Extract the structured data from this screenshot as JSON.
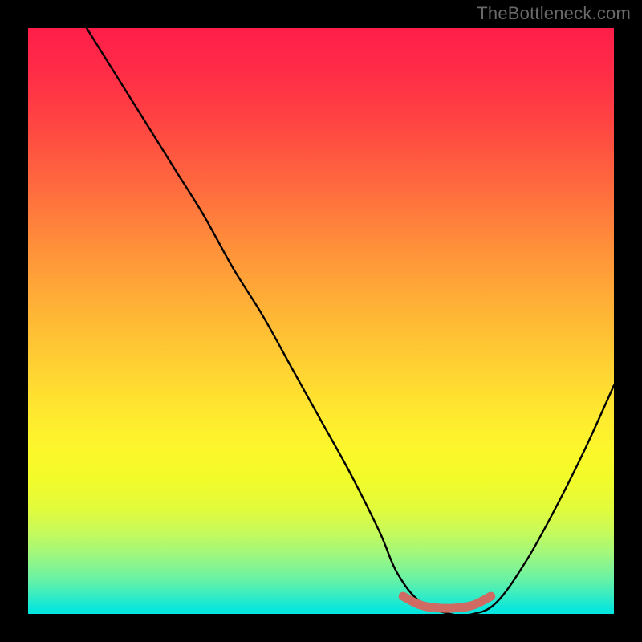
{
  "watermark": "TheBottleneck.com",
  "chart_data": {
    "type": "line",
    "title": "",
    "xlabel": "",
    "ylabel": "",
    "xlim": [
      0,
      100
    ],
    "ylim": [
      0,
      100
    ],
    "series": [
      {
        "name": "bottleneck-curve",
        "x": [
          10,
          15,
          20,
          25,
          30,
          35,
          40,
          45,
          50,
          55,
          60,
          63,
          67,
          72,
          76,
          80,
          85,
          90,
          95,
          100
        ],
        "y": [
          100,
          92,
          84,
          76,
          68,
          59,
          51,
          42,
          33,
          24,
          14,
          7,
          2,
          0,
          0,
          2,
          9,
          18,
          28,
          39
        ]
      },
      {
        "name": "optimal-range-marker",
        "x": [
          64,
          67,
          70,
          73,
          76,
          79
        ],
        "y": [
          3,
          1.5,
          1,
          1,
          1.5,
          3
        ]
      }
    ],
    "annotations": {
      "background": "red-yellow-green vertical gradient",
      "optimal_range_x": [
        64,
        79
      ]
    }
  },
  "colors": {
    "curve": "#000000",
    "marker": "#cf6b62",
    "frame": "#000000",
    "watermark": "#696969"
  }
}
